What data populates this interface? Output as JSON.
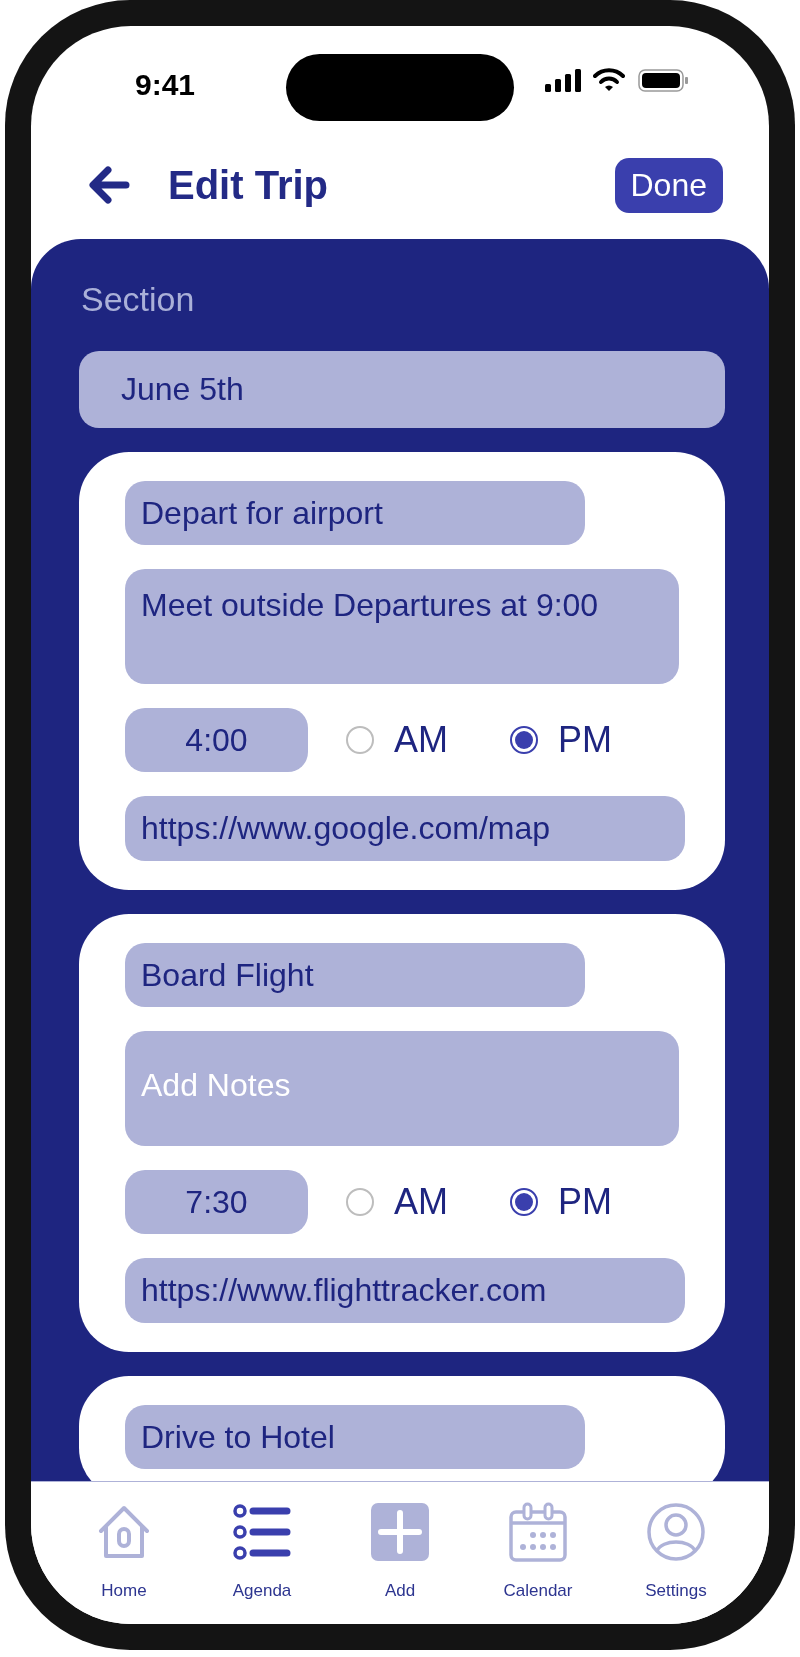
{
  "status_bar": {
    "time": "9:41"
  },
  "header": {
    "title": "Edit Trip",
    "done_button": "Done"
  },
  "section": {
    "label": "Section",
    "value": "June 5th"
  },
  "events": [
    {
      "title": "Depart for airport",
      "notes": {
        "value": "Meet outside Departures at 9:00"
      },
      "time": "4:00",
      "meridiem": [
        {
          "label": "AM",
          "selected": false
        },
        {
          "label": "PM",
          "selected": true
        }
      ],
      "link": "https://www.google.com/map"
    },
    {
      "title": "Board Flight",
      "notes": {
        "placeholder": "Add Notes"
      },
      "time": "7:30",
      "meridiem": [
        {
          "label": "AM",
          "selected": false
        },
        {
          "label": "PM",
          "selected": true
        }
      ],
      "link": "https://www.flighttracker.com"
    },
    {
      "title": "Drive to Hotel"
    }
  ],
  "tab_bar": [
    {
      "kind": "home",
      "label": "Home",
      "selected": false
    },
    {
      "kind": "agenda",
      "label": "Agenda",
      "selected": true
    },
    {
      "kind": "add",
      "label": "Add",
      "selected": false
    },
    {
      "kind": "calendar",
      "label": "Calendar",
      "selected": false
    },
    {
      "kind": "settings",
      "label": "Settings",
      "selected": false
    }
  ]
}
